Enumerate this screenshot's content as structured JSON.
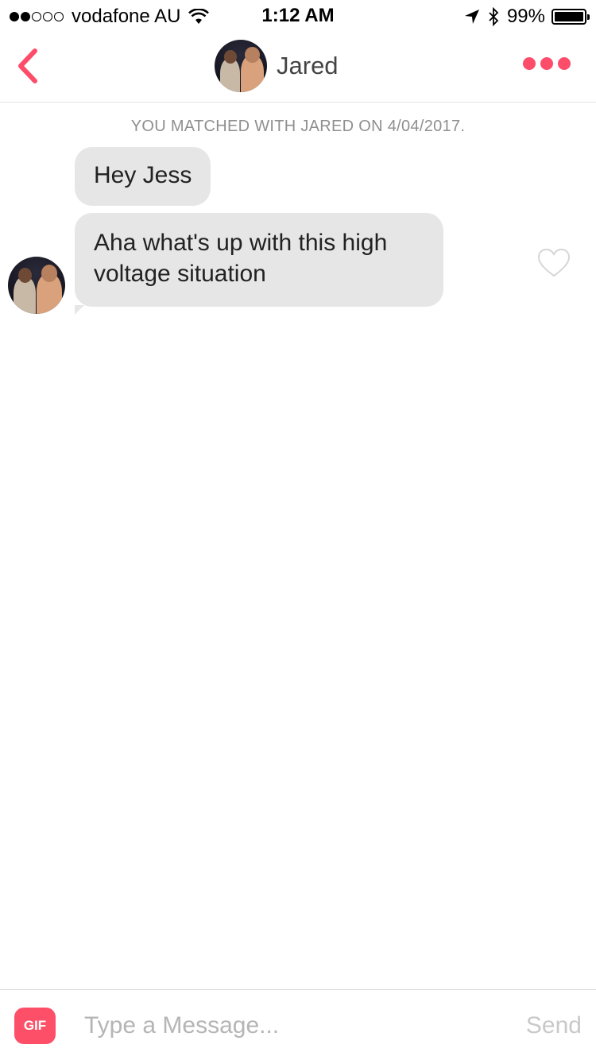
{
  "status_bar": {
    "carrier": "vodafone AU",
    "time": "1:12 AM",
    "battery_percent": "99%",
    "signal_bars_filled": 2,
    "signal_bars_total": 5
  },
  "header": {
    "contact_name": "Jared",
    "back_icon": "chevron-left-icon",
    "more_icon": "more-dots-icon"
  },
  "chat": {
    "match_note": "YOU MATCHED WITH JARED ON 4/04/2017.",
    "messages": [
      {
        "text": "Hey Jess",
        "from": "Jared"
      },
      {
        "text": "Aha what's up with this high voltage situation",
        "from": "Jared"
      }
    ],
    "like_icon": "heart-outline-icon"
  },
  "composer": {
    "gif_label": "GIF",
    "placeholder": "Type a Message...",
    "send_label": "Send"
  },
  "colors": {
    "accent": "#fd4d6a",
    "bubble_bg": "#e6e6e6",
    "muted_text": "#8f8f8f"
  }
}
